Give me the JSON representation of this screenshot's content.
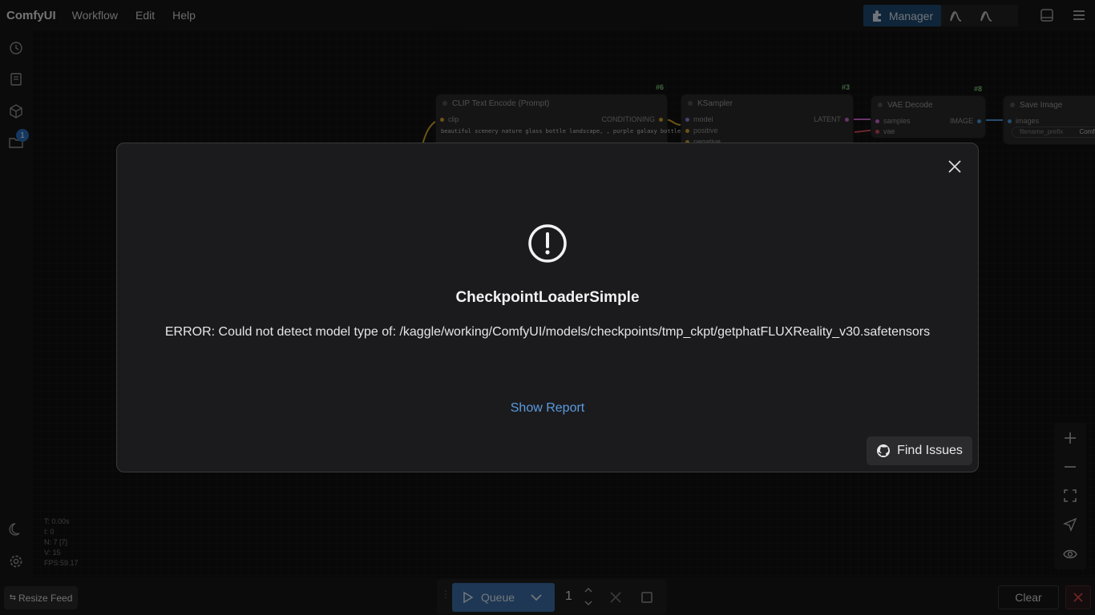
{
  "app": {
    "logo": "ComfyUI"
  },
  "menu": {
    "items": [
      "Workflow",
      "Edit",
      "Help"
    ]
  },
  "toolbar": {
    "manager_label": "Manager"
  },
  "sidebar": {
    "queue_badge": "1"
  },
  "nodes": {
    "clip": {
      "id": "#6",
      "title": "CLIP Text Encode (Prompt)",
      "input": "clip",
      "output": "CONDITIONING",
      "prompt": "beautiful scenery nature glass bottle landscape, , purple galaxy bottle,"
    },
    "ksampler": {
      "id": "#3",
      "title": "KSampler",
      "inputs": [
        "model",
        "positive",
        "negative"
      ],
      "output": "LATENT"
    },
    "vae": {
      "id": "#8",
      "title": "VAE Decode",
      "inputs": [
        "samples",
        "vae"
      ],
      "output": "IMAGE"
    },
    "save": {
      "title": "Save Image",
      "input": "images",
      "widget_label": "filename_prefix",
      "widget_value": "Comfy"
    }
  },
  "stats": {
    "t": "T: 0.00s",
    "i": "I: 0",
    "n": "N: 7 [7]",
    "v": "V: 15",
    "fps": "FPS:59.17"
  },
  "dialog": {
    "title": "CheckpointLoaderSimple",
    "message": "ERROR: Could not detect model type of: /kaggle/working/ComfyUI/models/checkpoints/tmp_ckpt/getphatFLUXReality_v30.safetensors",
    "show_report": "Show Report",
    "find_issues": "Find Issues"
  },
  "bottombar": {
    "resize_feed": "Resize Feed",
    "queue_label": "Queue",
    "queue_count": "1",
    "clear_label": "Clear"
  },
  "colors": {
    "accent": "#3a6ea8",
    "manager": "#1e4a72",
    "link": "#5b9be0",
    "node_id": "#7fc97f"
  }
}
